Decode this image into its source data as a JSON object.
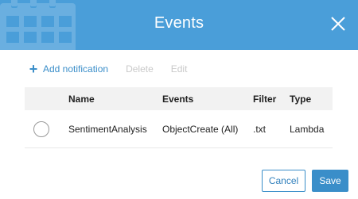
{
  "dialog": {
    "title": "Events",
    "header_color": "#4a9ed9",
    "accent_color": "#3a8ec9"
  },
  "toolbar": {
    "add_label": "Add notification",
    "add_icon": "plus-icon",
    "delete_label": "Delete",
    "edit_label": "Edit"
  },
  "table": {
    "columns": [
      "Name",
      "Events",
      "Filter",
      "Type"
    ],
    "rows": [
      {
        "selected": false,
        "name": "SentimentAnalysis",
        "events": "ObjectCreate (All)",
        "filter": ".txt",
        "type": "Lambda"
      }
    ]
  },
  "footer": {
    "cancel_label": "Cancel",
    "save_label": "Save"
  }
}
